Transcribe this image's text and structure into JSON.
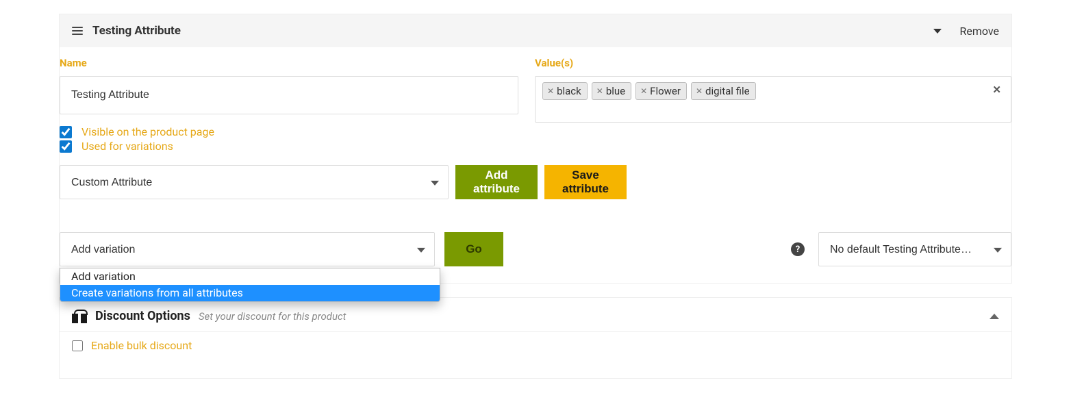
{
  "attribute": {
    "title": "Testing Attribute",
    "remove": "Remove",
    "name_label": "Name",
    "name_value": "Testing Attribute",
    "values_label": "Value(s)",
    "tags": [
      "black",
      "blue",
      "Flower",
      "digital file"
    ],
    "visible_label": "Visible on the product page",
    "visible_checked": true,
    "variations_label": "Used for variations",
    "variations_checked": true,
    "attr_type_selected": "Custom Attribute",
    "add_attribute": "Add attribute",
    "save_attribute": "Save attribute"
  },
  "variation": {
    "selected": "Add variation",
    "go": "Go",
    "options": [
      "Add variation",
      "Create variations from all attributes"
    ],
    "default_selected": "No default Testing Attribute…"
  },
  "discount": {
    "title": "Discount Options",
    "subtitle": "Set your discount for this product",
    "enable_label": "Enable bulk discount",
    "enable_checked": false
  }
}
